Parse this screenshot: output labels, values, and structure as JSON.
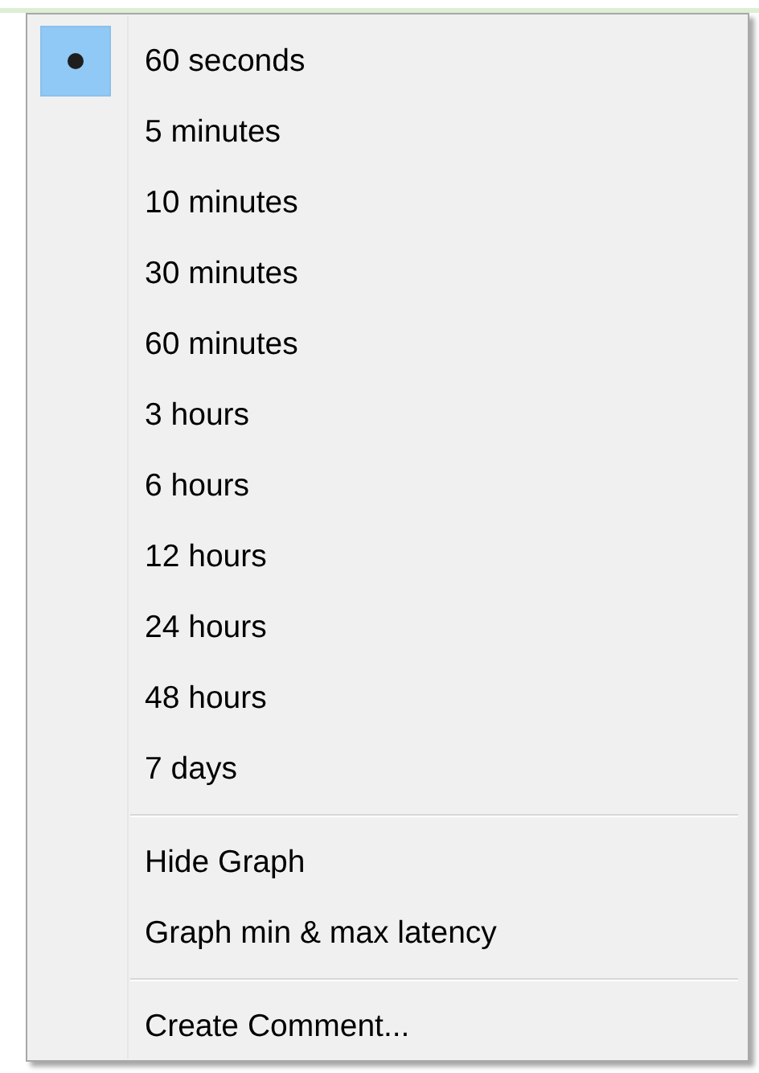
{
  "menu": {
    "items": [
      {
        "kind": "radio",
        "label": "60 seconds",
        "selected": true
      },
      {
        "kind": "radio",
        "label": "5 minutes",
        "selected": false
      },
      {
        "kind": "radio",
        "label": "10 minutes",
        "selected": false
      },
      {
        "kind": "radio",
        "label": "30 minutes",
        "selected": false
      },
      {
        "kind": "radio",
        "label": "60 minutes",
        "selected": false
      },
      {
        "kind": "radio",
        "label": "3 hours",
        "selected": false
      },
      {
        "kind": "radio",
        "label": "6 hours",
        "selected": false
      },
      {
        "kind": "radio",
        "label": "12 hours",
        "selected": false
      },
      {
        "kind": "radio",
        "label": "24 hours",
        "selected": false
      },
      {
        "kind": "radio",
        "label": "48 hours",
        "selected": false
      },
      {
        "kind": "radio",
        "label": "7 days",
        "selected": false
      },
      {
        "kind": "separator"
      },
      {
        "kind": "command",
        "label": "Hide Graph"
      },
      {
        "kind": "command",
        "label": "Graph min & max latency"
      },
      {
        "kind": "separator"
      },
      {
        "kind": "command",
        "label": "Create Comment..."
      }
    ]
  }
}
